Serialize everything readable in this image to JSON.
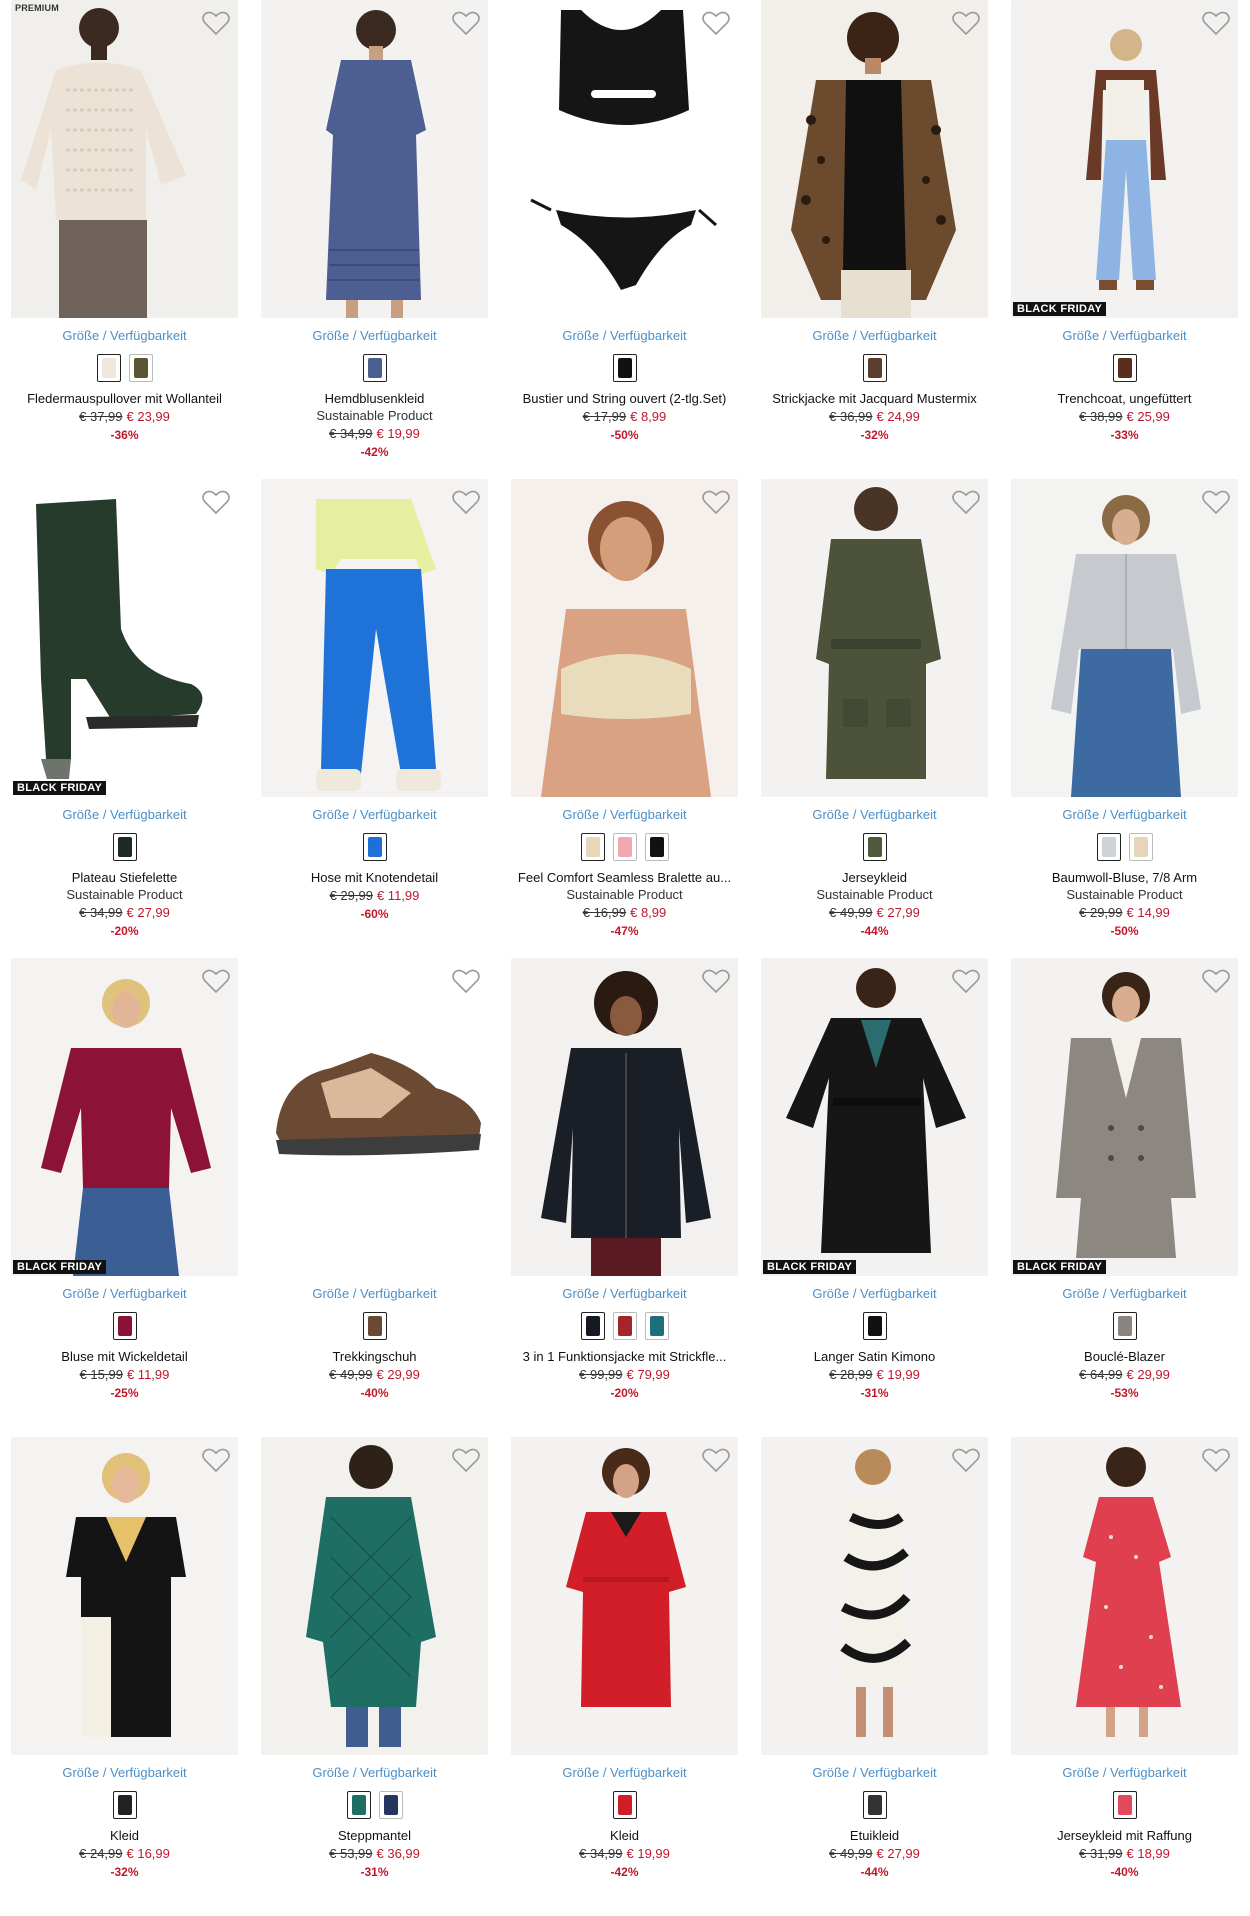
{
  "labels": {
    "size_link": "Größe / Verfügbarkeit",
    "black_friday": "BLACK FRIDAY",
    "premium": "PREMIUM",
    "sustainable": "Sustainable Product"
  },
  "colors": {
    "accent_link": "#4b8fc8",
    "sale": "#c0182b"
  },
  "products": [
    {
      "name": "Fledermauspullover mit Wollanteil",
      "old_price": "€ 37,99",
      "new_price": "€ 23,99",
      "discount": "-36%",
      "sub": "",
      "badge": "",
      "premium": true,
      "img": "pullover",
      "swatches": [
        "#efe7dc",
        "#5a5633"
      ]
    },
    {
      "name": "Hemdblusenkleid",
      "old_price": "€ 34,99",
      "new_price": "€ 19,99",
      "discount": "-42%",
      "sub": "Sustainable Product",
      "badge": "",
      "premium": false,
      "img": "blue-dress",
      "swatches": [
        "#4a5f8f"
      ]
    },
    {
      "name": "Bustier und String ouvert (2-tlg.Set)",
      "old_price": "€ 17,99",
      "new_price": "€ 8,99",
      "discount": "-50%",
      "sub": "",
      "badge": "",
      "premium": false,
      "img": "bikini",
      "swatches": [
        "#111111"
      ]
    },
    {
      "name": "Strickjacke mit Jacquard Mustermix",
      "old_price": "€ 36,99",
      "new_price": "€ 24,99",
      "discount": "-32%",
      "sub": "",
      "badge": "",
      "premium": false,
      "img": "leopard",
      "swatches": [
        "#5a3f2c"
      ]
    },
    {
      "name": "Trenchcoat, ungefüttert",
      "old_price": "€ 38,99",
      "new_price": "€ 25,99",
      "discount": "-33%",
      "sub": "",
      "badge": "BLACK FRIDAY",
      "premium": false,
      "img": "trench",
      "swatches": [
        "#5a2e1f"
      ]
    },
    {
      "name": "Plateau Stiefelette",
      "old_price": "€ 34,99",
      "new_price": "€ 27,99",
      "discount": "-20%",
      "sub": "Sustainable Product",
      "badge": "BLACK FRIDAY",
      "premium": false,
      "img": "boot",
      "swatches": [
        "#1e2b22"
      ]
    },
    {
      "name": "Hose mit Knotendetail",
      "old_price": "€ 29,99",
      "new_price": "€ 11,99",
      "discount": "-60%",
      "sub": "",
      "badge": "",
      "premium": false,
      "img": "blue-pants",
      "swatches": [
        "#1f6fd6"
      ]
    },
    {
      "name": "Feel Comfort Seamless Bralette au...",
      "old_price": "€ 16,99",
      "new_price": "€ 8,99",
      "discount": "-47%",
      "sub": "Sustainable Product",
      "badge": "",
      "premium": false,
      "img": "bralette",
      "swatches": [
        "#e8d7b8",
        "#f0a9b0",
        "#111111"
      ]
    },
    {
      "name": "Jerseykleid",
      "old_price": "€ 49,99",
      "new_price": "€ 27,99",
      "discount": "-44%",
      "sub": "Sustainable Product",
      "badge": "",
      "premium": false,
      "img": "olive-dress",
      "swatches": [
        "#4f5a3c"
      ]
    },
    {
      "name": "Baumwoll-Bluse, 7/8 Arm",
      "old_price": "€ 29,99",
      "new_price": "€ 14,99",
      "discount": "-50%",
      "sub": "Sustainable Product",
      "badge": "",
      "premium": false,
      "img": "grey-blouse",
      "swatches": [
        "#cfd2d6",
        "#e5d5bc"
      ]
    },
    {
      "name": "Bluse mit Wickeldetail",
      "old_price": "€ 15,99",
      "new_price": "€ 11,99",
      "discount": "-25%",
      "sub": "",
      "badge": "BLACK FRIDAY",
      "premium": false,
      "img": "wine-blouse",
      "swatches": [
        "#8a1235"
      ]
    },
    {
      "name": "Trekkingschuh",
      "old_price": "€ 49,99",
      "new_price": "€ 29,99",
      "discount": "-40%",
      "sub": "",
      "badge": "",
      "premium": false,
      "img": "shoe",
      "swatches": [
        "#6b4a33"
      ]
    },
    {
      "name": "3 in 1 Funktionsjacke mit Strickfle...",
      "old_price": "€ 99,99",
      "new_price": "€ 79,99",
      "discount": "-20%",
      "sub": "",
      "badge": "",
      "premium": false,
      "img": "black-jacket",
      "swatches": [
        "#151a22",
        "#a3242a",
        "#1d6f7c"
      ]
    },
    {
      "name": "Langer Satin Kimono",
      "old_price": "€ 28,99",
      "new_price": "€ 19,99",
      "discount": "-31%",
      "sub": "",
      "badge": "BLACK FRIDAY",
      "premium": false,
      "img": "kimono",
      "swatches": [
        "#111111"
      ]
    },
    {
      "name": "Bouclé-Blazer",
      "old_price": "€ 64,99",
      "new_price": "€ 29,99",
      "discount": "-53%",
      "sub": "",
      "badge": "BLACK FRIDAY",
      "premium": false,
      "img": "blazer",
      "swatches": [
        "#8a8580"
      ]
    },
    {
      "name": "Kleid",
      "old_price": "€ 24,99",
      "new_price": "€ 16,99",
      "discount": "-32%",
      "sub": "",
      "badge": "",
      "premium": false,
      "img": "colorblock",
      "swatches": [
        "#222222"
      ]
    },
    {
      "name": "Steppmantel",
      "old_price": "€ 53,99",
      "new_price": "€ 36,99",
      "discount": "-31%",
      "sub": "",
      "badge": "",
      "premium": false,
      "img": "quilted",
      "swatches": [
        "#1f6e63",
        "#263560"
      ]
    },
    {
      "name": "Kleid",
      "old_price": "€ 34,99",
      "new_price": "€ 19,99",
      "discount": "-42%",
      "sub": "",
      "badge": "",
      "premium": false,
      "img": "red-dress",
      "swatches": [
        "#d01e28"
      ]
    },
    {
      "name": "Etuikleid",
      "old_price": "€ 49,99",
      "new_price": "€ 27,99",
      "discount": "-44%",
      "sub": "",
      "badge": "",
      "premium": false,
      "img": "zebra",
      "swatches": [
        "#333333"
      ]
    },
    {
      "name": "Jerseykleid mit Raffung",
      "old_price": "€ 31,99",
      "new_price": "€ 18,99",
      "discount": "-40%",
      "sub": "",
      "badge": "",
      "premium": false,
      "img": "floral",
      "swatches": [
        "#e04a5a"
      ]
    }
  ]
}
